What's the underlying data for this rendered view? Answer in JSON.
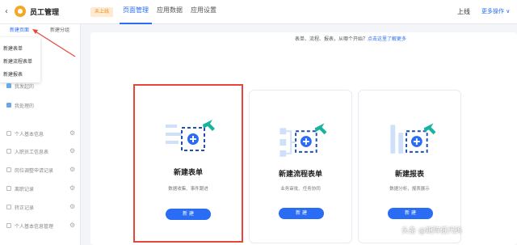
{
  "topbar": {
    "back_icon": "chevron-left-icon",
    "app_title": "员工管理",
    "status_badge": "未上线",
    "tabs": [
      {
        "label": "页面管理",
        "active": true
      },
      {
        "label": "应用数据",
        "active": false
      },
      {
        "label": "应用设置",
        "active": false
      }
    ],
    "publish_label": "上线",
    "more_label": "更多操作 ∨"
  },
  "sidebar": {
    "tabs": [
      {
        "label": "新建页面",
        "active": true
      },
      {
        "label": "新建分组",
        "active": false
      }
    ],
    "dropdown_items": [
      "新建表单",
      "新建流程表单",
      "新建报表"
    ],
    "items": [
      {
        "label": "我发起的",
        "icon": "folder-icon"
      },
      {
        "label": "我处理的",
        "icon": "folder-icon"
      },
      {
        "label": "个人基本信息",
        "icon": "form-icon"
      },
      {
        "label": "入职员工信息表",
        "icon": "form-icon"
      },
      {
        "label": "岗位调整申请记录",
        "icon": "form-icon"
      },
      {
        "label": "离职记录",
        "icon": "form-icon"
      },
      {
        "label": "转正记录",
        "icon": "form-icon"
      },
      {
        "label": "个人基本信息管理",
        "icon": "form-icon"
      }
    ]
  },
  "main": {
    "hint_text": "表单、流程、报表，从哪个开始？",
    "hint_link": "点击这里了解更多",
    "cards": [
      {
        "title": "新建表单",
        "desc": "数据收集、事件跟进",
        "button": "新 建",
        "icon": "form-plus-icon"
      },
      {
        "title": "新建流程表单",
        "desc": "业务审批、任务协同",
        "button": "新 建",
        "icon": "flow-plus-icon"
      },
      {
        "title": "新建报表",
        "desc": "数据分析，报表展示",
        "button": "新 建",
        "icon": "chart-plus-icon"
      }
    ]
  },
  "watermark": "头条 @矩阵低代码",
  "colors": {
    "accent": "#2a6cf4",
    "highlight": "#e8453c",
    "badge": "#f08c1a"
  }
}
